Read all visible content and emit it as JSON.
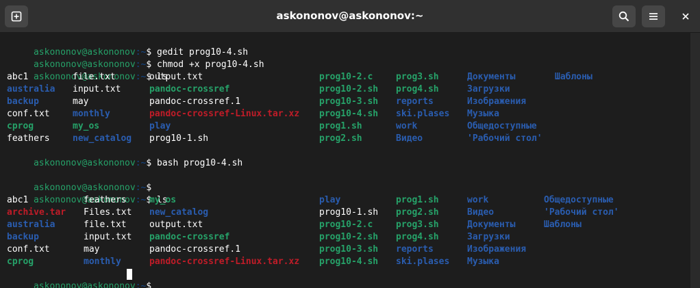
{
  "window": {
    "title": "askononov@askononov:~"
  },
  "prompt": {
    "user_host": "askononov@askononov",
    "path": ":~",
    "symbol": "$ "
  },
  "session": {
    "cmd1": "gedit prog10-4.sh",
    "cmd2": "chmod +x prog10-4.sh",
    "cmd3": "ls",
    "cmd4": "bash prog10-4.sh",
    "cmd5": "",
    "cmd6": "ls"
  },
  "listing1": {
    "rows": [
      [
        "abc1",
        "file.txt",
        "output.txt",
        "prog10-2.c",
        "prog3.sh",
        "Документы",
        "Шаблоны"
      ],
      [
        "australia",
        "input.txt",
        "pandoc-crossref",
        "prog10-2.sh",
        "prog4.sh",
        "Загрузки",
        ""
      ],
      [
        "backup",
        "may",
        "pandoc-crossref.1",
        "prog10-3.sh",
        "reports",
        "Изображения",
        ""
      ],
      [
        "conf.txt",
        "monthly",
        "pandoc-crossref-Linux.tar.xz",
        "prog10-4.sh",
        "ski.plases",
        "Музыка",
        ""
      ],
      [
        "cprog",
        "my_os",
        "play",
        "prog1.sh",
        "work",
        "Общедоступные",
        ""
      ],
      [
        "feathers",
        "new_catalog",
        "prog10-1.sh",
        "prog2.sh",
        "Видео",
        "'Рабочий стол'",
        ""
      ]
    ],
    "types": [
      [
        "file",
        "file",
        "file",
        "exec",
        "exec",
        "dir",
        "dir"
      ],
      [
        "dir",
        "file",
        "exec",
        "exec",
        "exec",
        "dir",
        ""
      ],
      [
        "dir",
        "file",
        "file",
        "exec",
        "dir",
        "dir",
        ""
      ],
      [
        "file",
        "dir",
        "arch",
        "exec",
        "dir",
        "dir",
        ""
      ],
      [
        "exec",
        "exec",
        "dir",
        "exec",
        "dir",
        "dir",
        ""
      ],
      [
        "file",
        "dir",
        "file",
        "exec",
        "dir",
        "dir",
        ""
      ]
    ]
  },
  "listing2": {
    "rows": [
      [
        "abc1",
        "feathers",
        "my_os",
        "play",
        "prog1.sh",
        "work",
        "Общедоступные"
      ],
      [
        "archive.tar",
        "Files.txt",
        "new_catalog",
        "prog10-1.sh",
        "prog2.sh",
        "Видео",
        "'Рабочий стол'"
      ],
      [
        "australia",
        "file.txt",
        "output.txt",
        "prog10-2.c",
        "prog3.sh",
        "Документы",
        "Шаблоны"
      ],
      [
        "backup",
        "input.txt",
        "pandoc-crossref",
        "prog10-2.sh",
        "prog4.sh",
        "Загрузки",
        ""
      ],
      [
        "conf.txt",
        "may",
        "pandoc-crossref.1",
        "prog10-3.sh",
        "reports",
        "Изображения",
        ""
      ],
      [
        "cprog",
        "monthly",
        "pandoc-crossref-Linux.tar.xz",
        "prog10-4.sh",
        "ski.plases",
        "Музыка",
        ""
      ]
    ],
    "types": [
      [
        "file",
        "file",
        "exec",
        "dir",
        "exec",
        "dir",
        "dir"
      ],
      [
        "arch",
        "file",
        "dir",
        "file",
        "exec",
        "dir",
        "dir"
      ],
      [
        "dir",
        "file",
        "file",
        "exec",
        "exec",
        "dir",
        "dir"
      ],
      [
        "dir",
        "file",
        "exec",
        "exec",
        "exec",
        "dir",
        ""
      ],
      [
        "file",
        "file",
        "file",
        "exec",
        "dir",
        "dir",
        ""
      ],
      [
        "exec",
        "dir",
        "arch",
        "exec",
        "dir",
        "dir",
        ""
      ]
    ]
  },
  "icons": {
    "new_tab": "new-tab-icon",
    "search": "search-icon",
    "menu": "hamburger-menu-icon",
    "close": "close-icon"
  },
  "colors": {
    "prompt_user": "#26a269",
    "prompt_path": "#12488b",
    "directory": "#2a5db0",
    "executable": "#26a269",
    "archive": "#c01c28",
    "text": "#ffffff",
    "background": "#1d1d1d"
  }
}
